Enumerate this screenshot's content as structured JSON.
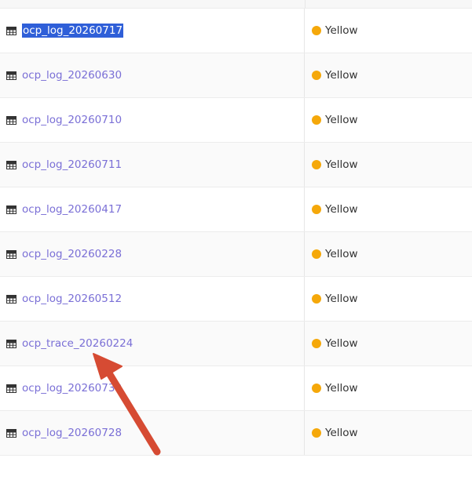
{
  "colors": {
    "link": "#7a6fd6",
    "selection_bg": "#2f5fd8",
    "selection_text": "#ffffff",
    "status_yellow": "#f5a80a",
    "annotation_arrow": "#d64b33"
  },
  "icons": {
    "row_icon": "table-grid-icon",
    "annotation": "arrow-icon"
  },
  "rows": [
    {
      "name": "ocp_log_20260717",
      "status": "Yellow",
      "selected": true
    },
    {
      "name": "ocp_log_20260630",
      "status": "Yellow"
    },
    {
      "name": "ocp_log_20260710",
      "status": "Yellow"
    },
    {
      "name": "ocp_log_20260711",
      "status": "Yellow"
    },
    {
      "name": "ocp_log_20260417",
      "status": "Yellow"
    },
    {
      "name": "ocp_log_20260228",
      "status": "Yellow"
    },
    {
      "name": "ocp_log_20260512",
      "status": "Yellow"
    },
    {
      "name": "ocp_trace_20260224",
      "status": "Yellow"
    },
    {
      "name": "ocp_log_20260730",
      "status": "Yellow"
    },
    {
      "name": "ocp_log_20260728",
      "status": "Yellow"
    }
  ]
}
